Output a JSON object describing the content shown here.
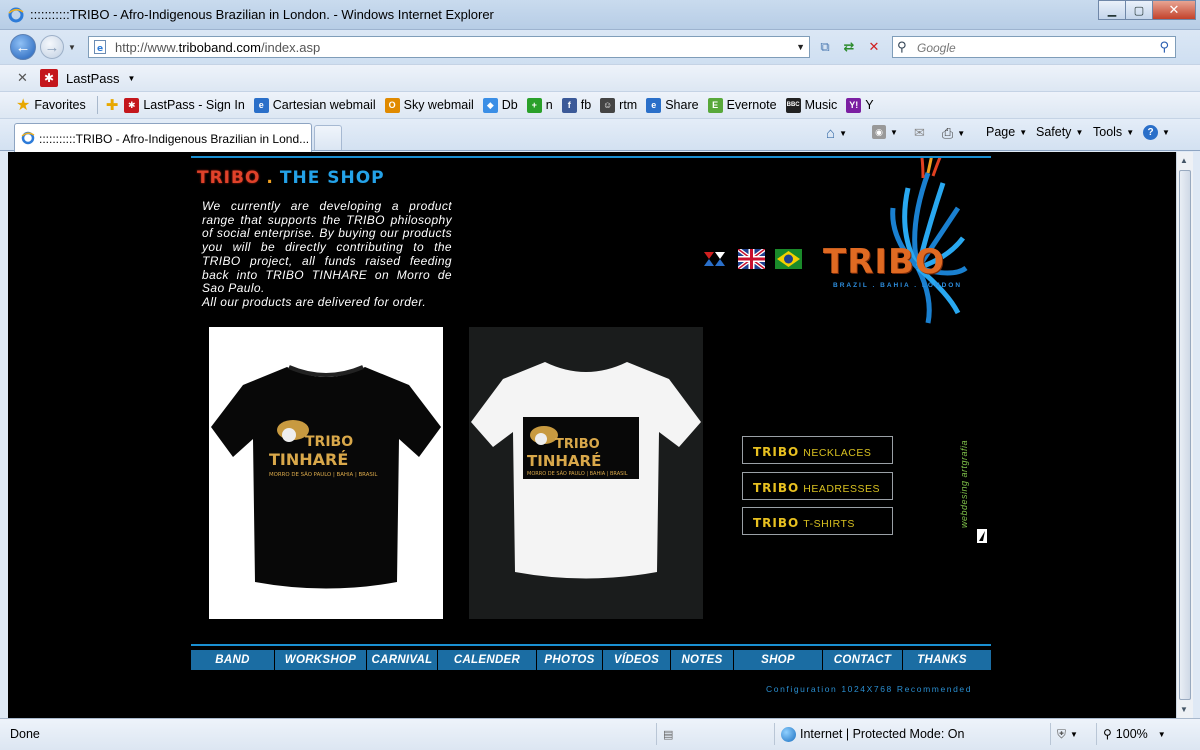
{
  "window": {
    "title": ":::::::::::TRIBO - Afro-Indigenous Brazilian in London. - Windows Internet Explorer",
    "min_icon": "minimize-icon",
    "max_icon": "maximize-icon",
    "close_icon": "close-icon"
  },
  "address": {
    "url_prefix": "http://www.",
    "url_domain": "triboband.com",
    "url_suffix": "/index.asp",
    "search_placeholder": "Google"
  },
  "lastpass": {
    "label": "LastPass"
  },
  "favorites": {
    "label": "Favorites",
    "items": [
      {
        "label": "LastPass - Sign In",
        "color": "#c4161c",
        "glyph": "✱"
      },
      {
        "label": "Cartesian webmail",
        "color": "#2a6fc9",
        "glyph": "e"
      },
      {
        "label": "Sky webmail",
        "color": "#e08a00",
        "glyph": "O"
      },
      {
        "label": "Db",
        "color": "#3a8ee6",
        "glyph": "◆"
      },
      {
        "label": "n",
        "color": "#2aa02a",
        "glyph": "+"
      },
      {
        "label": "fb",
        "color": "#3b5998",
        "glyph": "f"
      },
      {
        "label": "rtm",
        "color": "#444444",
        "glyph": "☺"
      },
      {
        "label": "Share",
        "color": "#2a6fc9",
        "glyph": "e"
      },
      {
        "label": "Evernote",
        "color": "#58a83a",
        "glyph": "E"
      },
      {
        "label": "Music",
        "color": "#222222",
        "glyph": "BBC"
      },
      {
        "label": "Y",
        "color": "#7b1fa2",
        "glyph": "Y!"
      }
    ]
  },
  "tab": {
    "label": ":::::::::::TRIBO - Afro-Indigenous Brazilian in Lond..."
  },
  "commands": {
    "page": "Page",
    "safety": "Safety",
    "tools": "Tools"
  },
  "site": {
    "title_1": "TRIBO",
    "title_sep": ".",
    "title_2": "THE SHOP",
    "intro": "We currently are developing a product range that supports the TRIBO philosophy of social enterprise. By buying our products you will be directly contributing to the TRIBO project, all funds raised feeding back into TRIBO TINHARE on Morro de Sao Paulo.",
    "intro_last": "All our products are delivered for order.",
    "logo_word": "TRIBO",
    "logo_sub": "BRAZIL . BAHIA . LONDON",
    "shirt_brand_1": "TRIBO",
    "shirt_brand_2": "TINHARÉ",
    "shirt_sub": "MORRO DE SÃO PAULO | BAHIA | BRASIL",
    "buttons": [
      {
        "brand": "TRIBO",
        "label": "NECKLACES"
      },
      {
        "brand": "TRIBO",
        "label": "HEADRESSES"
      },
      {
        "brand": "TRIBO",
        "label": "T-SHIRTS"
      }
    ],
    "credit": "webdesing artgrafia",
    "nav": [
      "BAND",
      "WORKSHOP",
      "CARNIVAL",
      "CALENDER",
      "PHOTOS",
      "VÍDEOS",
      "NOTES",
      "SHOP",
      "CONTACT",
      "THANKS"
    ],
    "config": "Configuration 1024X768 Recommended"
  },
  "status": {
    "text": "Done",
    "zone": "Internet | Protected Mode: On",
    "zoom": "100%"
  }
}
